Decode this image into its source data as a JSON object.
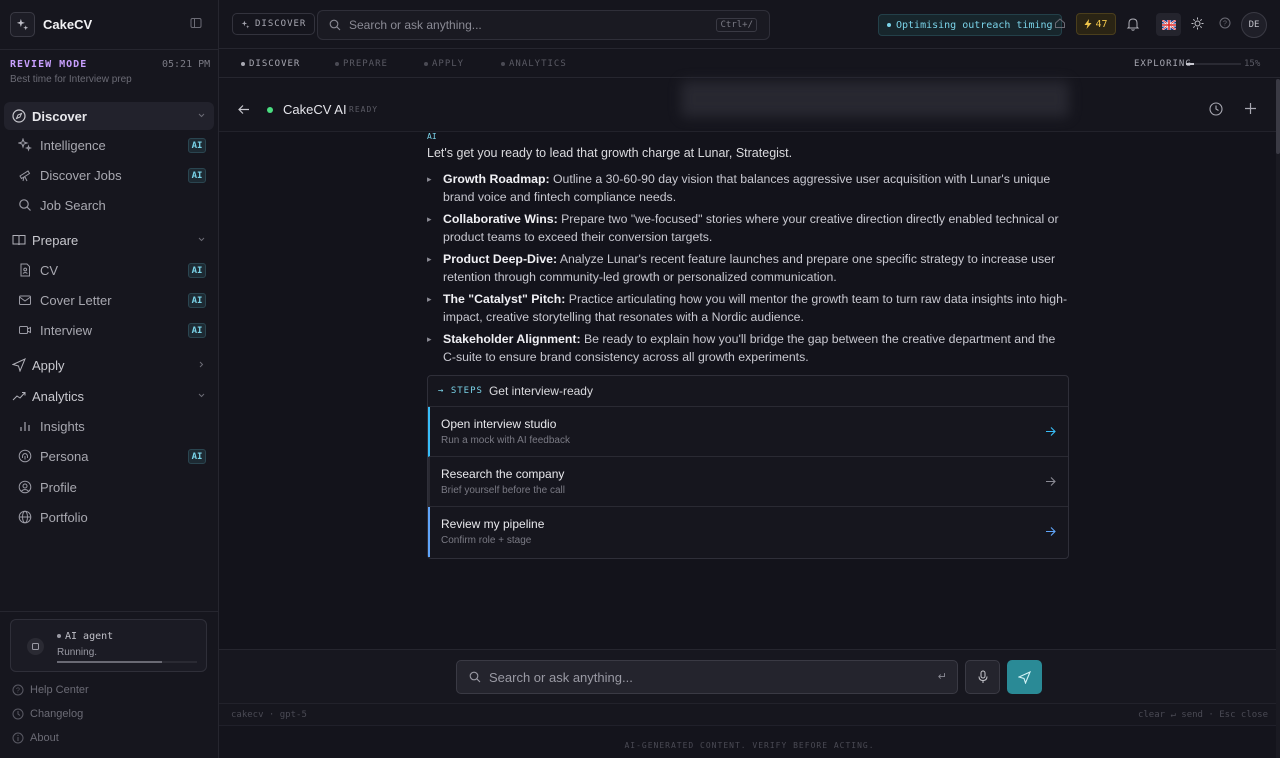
{
  "app": {
    "name": "CakeCV"
  },
  "sidebar": {
    "mode_label": "REVIEW MODE",
    "mode_time": "05:21 PM",
    "mode_sub": "Best time for Interview prep",
    "groups": [
      {
        "label": "Discover",
        "items": [
          {
            "label": "Intelligence",
            "badge": "AI"
          },
          {
            "label": "Discover Jobs",
            "badge": "AI"
          },
          {
            "label": "Job Search",
            "badge": ""
          }
        ]
      },
      {
        "label": "Prepare",
        "items": [
          {
            "label": "CV",
            "badge": "AI"
          },
          {
            "label": "Cover Letter",
            "badge": "AI"
          },
          {
            "label": "Interview",
            "badge": "AI"
          }
        ]
      },
      {
        "label": "Apply",
        "items": []
      },
      {
        "label": "Analytics",
        "items": [
          {
            "label": "Insights",
            "badge": ""
          },
          {
            "label": "Persona",
            "badge": "AI"
          },
          {
            "label": "Profile",
            "badge": ""
          },
          {
            "label": "Portfolio",
            "badge": ""
          }
        ]
      }
    ],
    "agent": {
      "title": "AI agent",
      "status": "Running.",
      "progress": 0.75
    },
    "footer": {
      "help": "Help Center",
      "changelog": "Changelog",
      "about": "About"
    }
  },
  "topbar": {
    "section": "DISCOVER",
    "search_placeholder": "Search or ask anything...",
    "shortcut": "Ctrl+/",
    "status": "Optimising outreach timing",
    "credits": "47",
    "avatar": "DE"
  },
  "progress_tabs": {
    "tabs": [
      "DISCOVER",
      "PREPARE",
      "APPLY",
      "ANALYTICS"
    ],
    "active": 0,
    "exploring_label": "EXPLORING",
    "exploring_pct": "15%",
    "exploring_value": 0.15
  },
  "chat": {
    "title": "CakeCV AI",
    "state": "READY",
    "message_tag": "AI",
    "intro": "Let's get you ready to lead that growth charge at Lunar, Strategist.",
    "bullets": [
      {
        "title": "Growth Roadmap:",
        "text": " Outline a 30-60-90 day vision that balances aggressive user acquisition with Lunar's unique brand voice and fintech compliance needs."
      },
      {
        "title": "Collaborative Wins:",
        "text": " Prepare two \"we-focused\" stories where your creative direction directly enabled technical or product teams to exceed their conversion targets."
      },
      {
        "title": "Product Deep-Dive:",
        "text": " Analyze Lunar's recent feature launches and prepare one specific strategy to increase user retention through community-led growth or personalized communication."
      },
      {
        "title": "The \"Catalyst\" Pitch:",
        "text": " Practice articulating how you will mentor the growth team to turn raw data insights into high-impact, creative storytelling that resonates with a Nordic audience."
      },
      {
        "title": "Stakeholder Alignment:",
        "text": " Be ready to explain how you'll bridge the gap between the creative department and the C-suite to ensure brand consistency across all growth experiments."
      }
    ],
    "steps": {
      "tag": "→ STEPS",
      "title": "Get interview-ready",
      "items": [
        {
          "title": "Open interview studio",
          "sub": "Run a mock with AI feedback"
        },
        {
          "title": "Research the company",
          "sub": "Brief yourself before the call"
        },
        {
          "title": "Review my pipeline",
          "sub": "Confirm role + stage"
        }
      ]
    }
  },
  "composer": {
    "placeholder": "Search or ask anything...",
    "enter_glyph": "↵",
    "meta_left": "cakecv · gpt-5",
    "meta_right": "clear  ↵ send · Esc close",
    "disclaimer": "AI-GENERATED CONTENT. VERIFY BEFORE ACTING."
  },
  "colors": {
    "accent": "#7ad3e8",
    "mode": "#c9a0ff",
    "live": "#4ade80",
    "send": "#2a8a96",
    "credits": "#f0c64a"
  }
}
